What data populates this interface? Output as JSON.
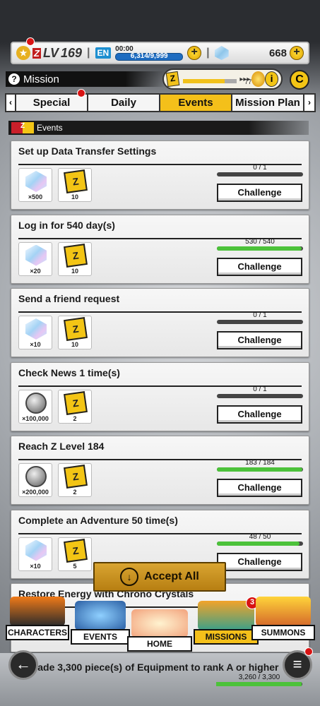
{
  "header": {
    "level_prefix": "LV",
    "level": "169",
    "energy_label": "EN",
    "energy_timer": "00:00",
    "energy_value": "6,314/9,999",
    "crystals": "668"
  },
  "mission_title": "Mission",
  "zpass": {
    "value": "77",
    "fill": 0.77
  },
  "tabs": [
    "Special",
    "Daily",
    "Events",
    "Mission Plan"
  ],
  "active_tab": "Events",
  "section_title": "Events",
  "missions": [
    {
      "title": "Set up Data Transfer Settings",
      "rewards": [
        {
          "icon": "chrono-crystal-icon",
          "qty": "×500"
        },
        {
          "icon": "z-power-icon",
          "qty": "10"
        }
      ],
      "progress_text": "0 / 1",
      "progress": 0,
      "button": "Challenge"
    },
    {
      "title": "Log in for 540 day(s)",
      "rewards": [
        {
          "icon": "chrono-crystal-icon",
          "qty": "×20"
        },
        {
          "icon": "z-power-icon",
          "qty": "10"
        }
      ],
      "progress_text": "530 / 540",
      "progress": 0.98,
      "button": "Challenge"
    },
    {
      "title": "Send a friend request",
      "rewards": [
        {
          "icon": "chrono-crystal-icon",
          "qty": "×10"
        },
        {
          "icon": "z-power-icon",
          "qty": "10"
        }
      ],
      "progress_text": "0 / 1",
      "progress": 0,
      "button": "Challenge"
    },
    {
      "title": "Check News 1 time(s)",
      "rewards": [
        {
          "icon": "zeni-coin-icon",
          "qty": "×100,000"
        },
        {
          "icon": "z-power-icon",
          "qty": "2"
        }
      ],
      "progress_text": "0 / 1",
      "progress": 0,
      "button": "Challenge"
    },
    {
      "title": "Reach Z Level 184",
      "rewards": [
        {
          "icon": "zeni-coin-icon",
          "qty": "×200,000"
        },
        {
          "icon": "z-power-icon",
          "qty": "2"
        }
      ],
      "progress_text": "183 / 184",
      "progress": 0.99,
      "button": "Challenge"
    },
    {
      "title": "Complete an Adventure 50 time(s)",
      "rewards": [
        {
          "icon": "chrono-crystal-icon",
          "qty": "×10"
        },
        {
          "icon": "z-power-icon",
          "qty": "5"
        }
      ],
      "progress_text": "48 / 50",
      "progress": 0.96,
      "button": "Challenge"
    },
    {
      "title": "Restore Energy with Chrono Crystals",
      "rewards": [],
      "progress_text": "",
      "progress": 0,
      "button": ""
    }
  ],
  "accept_all": "Accept All",
  "nav": {
    "characters": "CHARACTERS",
    "events": "EVENTS",
    "home": "HOME",
    "missions": "MISSIONS",
    "missions_badge": "3",
    "summons": "SUMMONS"
  },
  "bottom_mission": {
    "title": "Trade 3,300 piece(s) of Equipment to rank A or higher",
    "progress_text": "3,260 / 3,300",
    "progress": 0.99
  },
  "colors": {
    "accent": "#f4c01a",
    "progress": "#4cc23a",
    "alert": "#d81313"
  }
}
